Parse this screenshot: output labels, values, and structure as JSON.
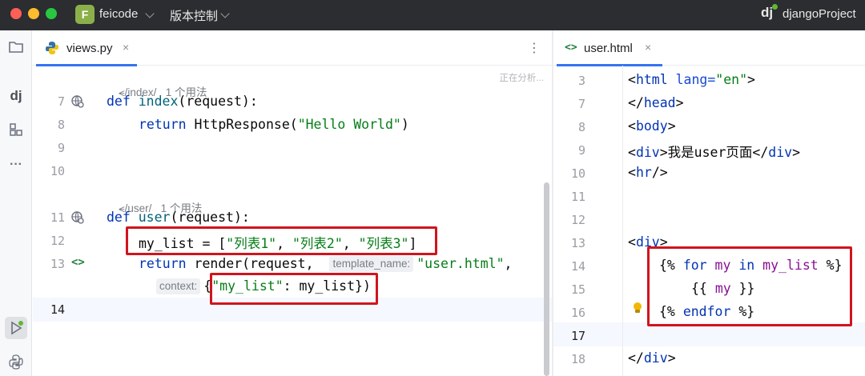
{
  "titlebar": {
    "project_badge": "F",
    "project_name": "feicode",
    "vcs_menu": "版本控制",
    "ide_logo": "dj",
    "django_project": "djangoProject"
  },
  "left_editor": {
    "tab_label": "views.py",
    "tab_close": "×",
    "status_text": "正在分析...",
    "route_hints": [
      {
        "route": "/index/",
        "usages": "1 个用法"
      },
      {
        "route": "/user/",
        "usages": "1 个用法"
      }
    ],
    "gutter": [
      "7",
      "8",
      "9",
      "10",
      "11",
      "12",
      "13",
      "14"
    ],
    "code": {
      "l7_kw": "def",
      "l7_fn": "index",
      "l7_rest": "(request):",
      "l8_kw": "return",
      "l8_a": "HttpResponse(",
      "l8_str": "\"Hello World\"",
      "l8_b": ")",
      "l11_kw": "def",
      "l11_fn": "user",
      "l11_rest": "(request):",
      "l12_a": "my_list = [",
      "l12_s1": "\"列表1\"",
      "l12_c1": ", ",
      "l12_s2": "\"列表2\"",
      "l12_c2": ", ",
      "l12_s3": "\"列表3\"",
      "l12_b": "]",
      "l13_kw": "return",
      "l13_a": "render(request,",
      "l13_hint": "template_name:",
      "l13_str": "\"user.html\"",
      "l13_b": ",",
      "l13c_hint": "context:",
      "l13c_a": "{",
      "l13c_str": "\"my_list\"",
      "l13c_b": ": my_list}",
      "l13c_c": ")"
    }
  },
  "right_editor": {
    "tab_icon": "<>",
    "tab_label": "user.html",
    "tab_close": "×",
    "gutter": [
      "3",
      "7",
      "8",
      "9",
      "10",
      "11",
      "12",
      "13",
      "14",
      "15",
      "16",
      "17",
      "18"
    ],
    "code": {
      "l3_a": "<",
      "l3_tag": "html",
      "l3_attr": " lang=",
      "l3_val": "\"en\"",
      "l3_b": ">",
      "l7_a": "</",
      "l7_tag": "head",
      "l7_b": ">",
      "l8_a": "<",
      "l8_tag": "body",
      "l8_b": ">",
      "l9_a": "<",
      "l9_tag": "div",
      "l9_b": ">我是user页面</",
      "l9_tag2": "div",
      "l9_c": ">",
      "l10_a": "<",
      "l10_tag": "hr",
      "l10_b": "/>",
      "l13_a": "<",
      "l13_tag": "div",
      "l13_b": ">",
      "l14_a": "{% ",
      "l14_kw1": "for",
      "l14_var1": " my ",
      "l14_kw2": "in",
      "l14_var2": " my_list",
      "l14_b": " %}",
      "l15_a": "{{ ",
      "l15_var": "my",
      "l15_b": " }}",
      "l16_a": "{% ",
      "l16_kw": "endfor",
      "l16_b": " %}",
      "l18_a": "</",
      "l18_tag": "div",
      "l18_b": ">"
    }
  },
  "toolstrip": {
    "icons": [
      "folder-icon",
      "django-icon",
      "structure-icon",
      "more-icon",
      "run-icon",
      "python-console-icon"
    ],
    "more_glyph": "···",
    "django_glyph": "dj"
  },
  "colors": {
    "titlebar_bg": "#2b2d30",
    "accent": "#3574f0",
    "highlight_box": "#d1141d",
    "keyword": "#0033b3",
    "string": "#067d17",
    "function": "#00627a"
  }
}
